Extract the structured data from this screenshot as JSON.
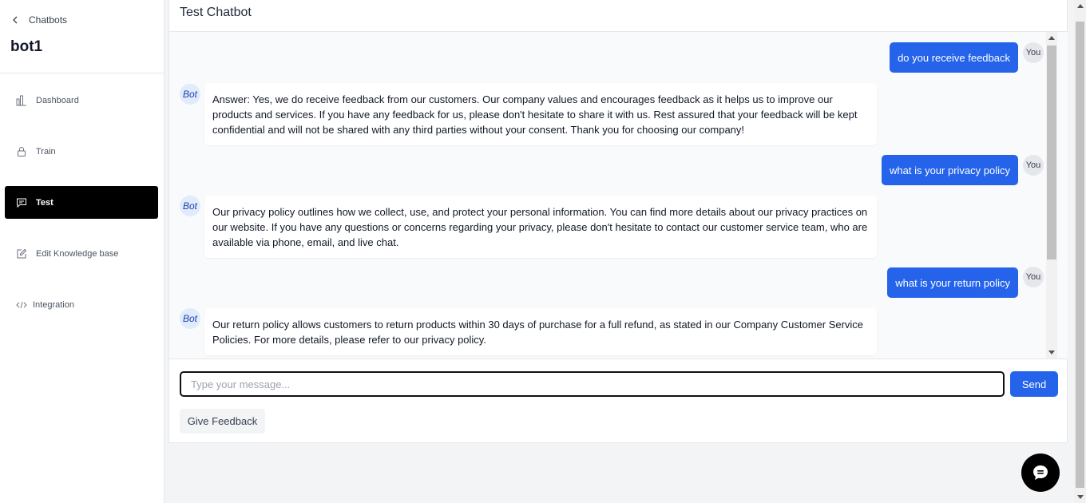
{
  "sidebar": {
    "back_label": "Chatbots",
    "bot_name": "bot1",
    "items": [
      {
        "label": "Dashboard",
        "icon": "bar-chart-icon"
      },
      {
        "label": "Train",
        "icon": "lock-icon"
      },
      {
        "label": "Test",
        "icon": "message-square-icon",
        "active": true
      },
      {
        "label": "Edit Knowledge base",
        "icon": "edit-icon"
      },
      {
        "label": "Integration",
        "icon": "code-icon"
      }
    ]
  },
  "header": {
    "title": "Test Chatbot"
  },
  "avatars": {
    "user": "You",
    "bot": "Bot"
  },
  "messages": [
    {
      "role": "user",
      "text": "do you receive feedback"
    },
    {
      "role": "bot",
      "text": "Answer: Yes, we do receive feedback from our customers. Our company values and encourages feedback as it helps us to improve our products and services. If you have any feedback for us, please don't hesitate to share it with us. Rest assured that your feedback will be kept confidential and will not be shared with any third parties without your consent. Thank you for choosing our company!"
    },
    {
      "role": "user",
      "text": "what is your privacy policy"
    },
    {
      "role": "bot",
      "text": "Our privacy policy outlines how we collect, use, and protect your personal information. You can find more details about our privacy practices on our website. If you have any questions or concerns regarding your privacy, please don't hesitate to contact our customer service team, who are available via phone, email, and live chat."
    },
    {
      "role": "user",
      "text": "what is your return policy"
    },
    {
      "role": "bot",
      "text": "Our return policy allows customers to return products within 30 days of purchase for a full refund, as stated in our Company Customer Service Policies. For more details, please refer to our privacy policy."
    }
  ],
  "composer": {
    "placeholder": "Type your message...",
    "value": "",
    "send_label": "Send"
  },
  "feedback_label": "Give Feedback",
  "colors": {
    "accent": "#2563eb",
    "active_nav": "#000000",
    "user_bubble": "#2563eb"
  }
}
